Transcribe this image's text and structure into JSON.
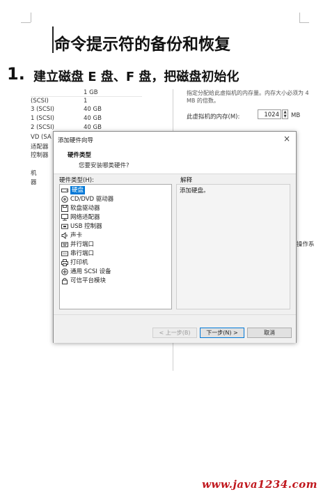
{
  "document": {
    "title": "命令提示符的备份和恢复",
    "section_number": "1.",
    "section_text": "建立磁盘 E 盘、F 盘，把磁盘初始化"
  },
  "background_window": {
    "rows": [
      {
        "left": "",
        "value": "1 GB"
      },
      {
        "left": "(SCSI)",
        "value": "1"
      },
      {
        "left": "3 (SCSI)",
        "value": "40 GB"
      },
      {
        "left": "1 (SCSI)",
        "value": "40 GB"
      },
      {
        "left": "2 (SCSI)",
        "value": "40 GB"
      },
      {
        "left": "VD (SA",
        "value": ""
      },
      {
        "left": "适配器",
        "value": ""
      },
      {
        "left": "控制器",
        "value": ""
      },
      {
        "left": "机",
        "value": ""
      },
      {
        "left": "器",
        "value": ""
      }
    ],
    "hint_text": "指定分配给此虚拟机的内存量。内存大小必须为 4 MB 的倍数。",
    "memory_label": "此虚拟机的内存(M):",
    "memory_value": "1024",
    "memory_unit": "MB",
    "os_fragment": "操作系"
  },
  "dialog": {
    "title": "添加硬件向导",
    "header_title": "硬件类型",
    "header_subtitle": "您要安装哪类硬件?",
    "list_label": "硬件类型(H):",
    "explain_label": "解释",
    "explain_text": "添加硬盘。",
    "hardware_items": [
      {
        "label": "硬盘",
        "icon": "hard-disk-icon",
        "selected": true
      },
      {
        "label": "CD/DVD 驱动器",
        "icon": "cd-dvd-icon",
        "selected": false
      },
      {
        "label": "软盘驱动器",
        "icon": "floppy-icon",
        "selected": false
      },
      {
        "label": "网络适配器",
        "icon": "network-adapter-icon",
        "selected": false
      },
      {
        "label": "USB 控制器",
        "icon": "usb-icon",
        "selected": false
      },
      {
        "label": "声卡",
        "icon": "speaker-icon",
        "selected": false
      },
      {
        "label": "并行端口",
        "icon": "parallel-port-icon",
        "selected": false
      },
      {
        "label": "串行端口",
        "icon": "serial-port-icon",
        "selected": false
      },
      {
        "label": "打印机",
        "icon": "printer-icon",
        "selected": false
      },
      {
        "label": "通用 SCSI 设备",
        "icon": "scsi-icon",
        "selected": false
      },
      {
        "label": "可信平台模块",
        "icon": "tpm-icon",
        "selected": false
      }
    ],
    "buttons": {
      "back": "< 上一步(B)",
      "next": "下一步(N) >",
      "cancel": "取消"
    },
    "close_glyph": "×"
  },
  "watermark": "www.java1234.com",
  "colors": {
    "selection": "#0078d7",
    "watermark": "#c0181e"
  }
}
